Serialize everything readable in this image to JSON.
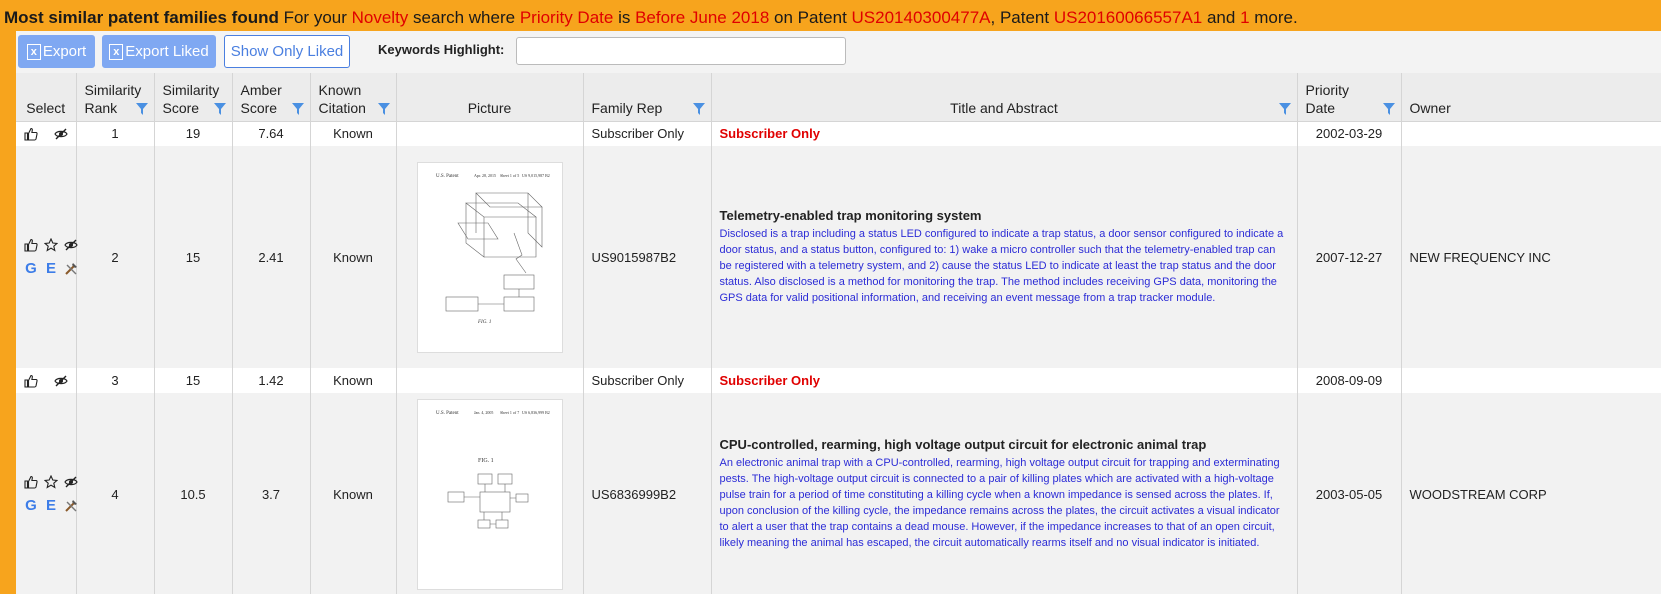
{
  "banner": {
    "lead": "Most similar patent families found",
    "t1": " For your ",
    "search_type": "Novelty",
    "t2": " search where ",
    "field": "Priority Date",
    "t3": " is ",
    "condition": "Before June 2018",
    "t4": " on Patent ",
    "patent1": "US20140300477A",
    "t5": ", Patent ",
    "patent2": "US20160066557A1",
    "t6": " and ",
    "more_count": "1",
    "t7": " more."
  },
  "toolbar": {
    "export_label": "Export",
    "export_liked_label": "Export Liked",
    "show_only_liked_label": "Show Only Liked",
    "keywords_label": "Keywords Highlight:",
    "keywords_value": ""
  },
  "columns": {
    "select": "Select",
    "similarity_rank_1": "Similarity",
    "similarity_rank_2": "Rank",
    "similarity_score_1": "Similarity",
    "similarity_score_2": "Score",
    "amber_score_1": "Amber",
    "amber_score_2": "Score",
    "known_citation_1": "Known",
    "known_citation_2": "Citation",
    "picture": "Picture",
    "family_rep": "Family Rep",
    "title_abstract": "Title and Abstract",
    "priority_date_1": "Priority",
    "priority_date_2": "Date",
    "owner": "Owner"
  },
  "icons": {
    "google": "G",
    "espacenet": "E",
    "like": "thumbs-up-icon",
    "favorite": "star-icon",
    "hide": "eye-slash-icon",
    "tools": "tools-icon"
  },
  "rows": [
    {
      "rank": "1",
      "score": "19",
      "amber": "7.64",
      "citation": "Known",
      "family_rep": "Subscriber Only",
      "title": "Subscriber Only",
      "abstract": "",
      "priority_date": "2002-03-29",
      "owner": ""
    },
    {
      "rank": "2",
      "score": "15",
      "amber": "2.41",
      "citation": "Known",
      "family_rep": "US9015987B2",
      "title": "Telemetry-enabled trap monitoring system",
      "abstract": "Disclosed is a trap including a status LED configured to indicate a trap status, a door sensor configured to indicate a door status, and a status button, configured to: 1) wake a micro controller such that the telemetry-enabled trap can be registered with a telemetry system, and 2) cause the status LED to indicate at least the trap status and the door status. Also disclosed is a method for monitoring the trap. The method includes receiving GPS data, monitoring the GPS data for valid positional information, and receiving an event message from a trap tracker module.",
      "priority_date": "2007-12-27",
      "owner": "NEW FREQUENCY INC",
      "drawing": {
        "header_left": "U.S. Patent",
        "header_mid": "Apr. 28, 2015",
        "header_sheet": "Sheet 1 of 5",
        "header_right": "US 9,015,987 B2",
        "caption": "FIG. 1"
      }
    },
    {
      "rank": "3",
      "score": "15",
      "amber": "1.42",
      "citation": "Known",
      "family_rep": "Subscriber Only",
      "title": "Subscriber Only",
      "abstract": "",
      "priority_date": "2008-09-09",
      "owner": ""
    },
    {
      "rank": "4",
      "score": "10.5",
      "amber": "3.7",
      "citation": "Known",
      "family_rep": "US6836999B2",
      "title": "CPU-controlled, rearming, high voltage output circuit for electronic animal trap",
      "abstract": "An electronic animal trap with a CPU-controlled, rearming, high voltage output circuit for trapping and exterminating pests. The high-voltage output circuit is connected to a pair of killing plates which are activated with a high-voltage pulse train for a period of time constituting a killing cycle when a known impedance is sensed across the plates. If, upon conclusion of the killing cycle, the impedance remains across the plates, the circuit activates a visual indicator to alert a user that the trap contains a dead mouse. However, if the impedance increases to that of an open circuit, likely meaning the animal has escaped, the circuit automatically rearms itself and no visual indicator is initiated.",
      "priority_date": "2003-05-05",
      "owner": "WOODSTREAM CORP",
      "drawing": {
        "header_left": "U.S. Patent",
        "header_mid": "Jan. 4, 2005",
        "header_sheet": "Sheet 1 of 7",
        "header_right": "US 6,836,999 B2",
        "caption": "FIG. 1"
      }
    }
  ],
  "colors": {
    "banner_bg": "#f7a41d",
    "highlight": "#e00000",
    "button_primary": "#7fa8f2",
    "abstract_text": "#2c2cd6",
    "filter_icon": "#4a90e2"
  }
}
